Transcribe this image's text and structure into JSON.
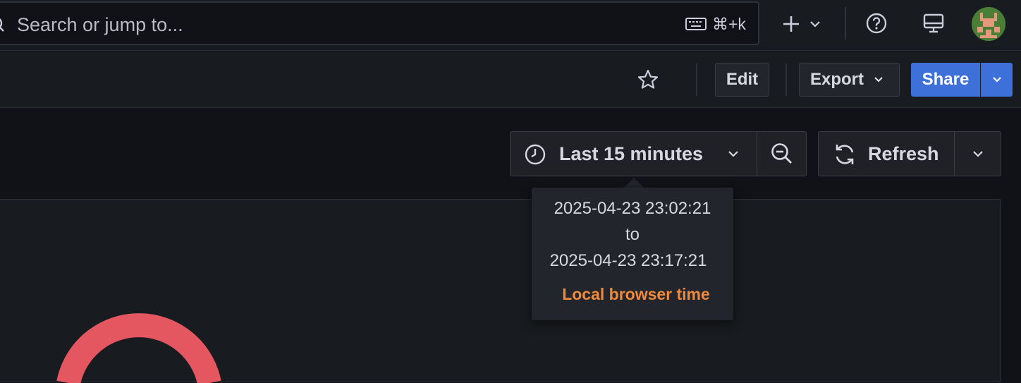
{
  "search": {
    "placeholder": "Search or jump to...",
    "shortcut": "⌘+k"
  },
  "topbar": {
    "icons": [
      "plus-icon",
      "chevron-down-icon",
      "help-icon",
      "monitor-icon"
    ]
  },
  "toolbar": {
    "edit_label": "Edit",
    "export_label": "Export",
    "share_label": "Share"
  },
  "time_picker": {
    "label": "Last 15 minutes"
  },
  "refresh": {
    "label": "Refresh"
  },
  "tooltip": {
    "from": "2025-04-23 23:02:21",
    "separator": "to",
    "to": "2025-04-23 23:17:21",
    "timezone": "Local browser time"
  },
  "colors": {
    "accent_blue": "#3d71d9",
    "timezone_orange": "#f08a3a",
    "gauge_red": "#e45760"
  }
}
